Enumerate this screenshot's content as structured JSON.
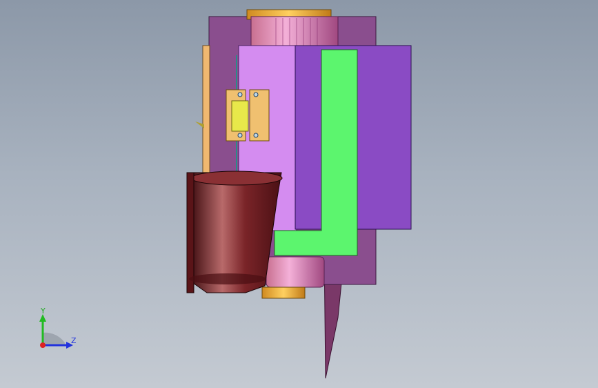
{
  "viewport": {
    "background_top": "#8c98a8",
    "background_bottom": "#c4cad2"
  },
  "triad": {
    "y_label": "Y",
    "z_label": "Z",
    "y_color": "#22bb22",
    "z_color": "#2233dd",
    "x_color": "#dd2222"
  },
  "model": {
    "colors": {
      "purple_plate": "#8a4e8e",
      "violet_block": "#d48cf0",
      "violet_block_dark": "#8a4bc4",
      "green_frame": "#5cf56e",
      "orange_parts": "#f0b050",
      "yellow_bracket": "#e8e84a",
      "pink_cylinder": "#e090c8",
      "maroon_motor": "#6a1e22",
      "dark_blade": "#7a3868"
    }
  }
}
